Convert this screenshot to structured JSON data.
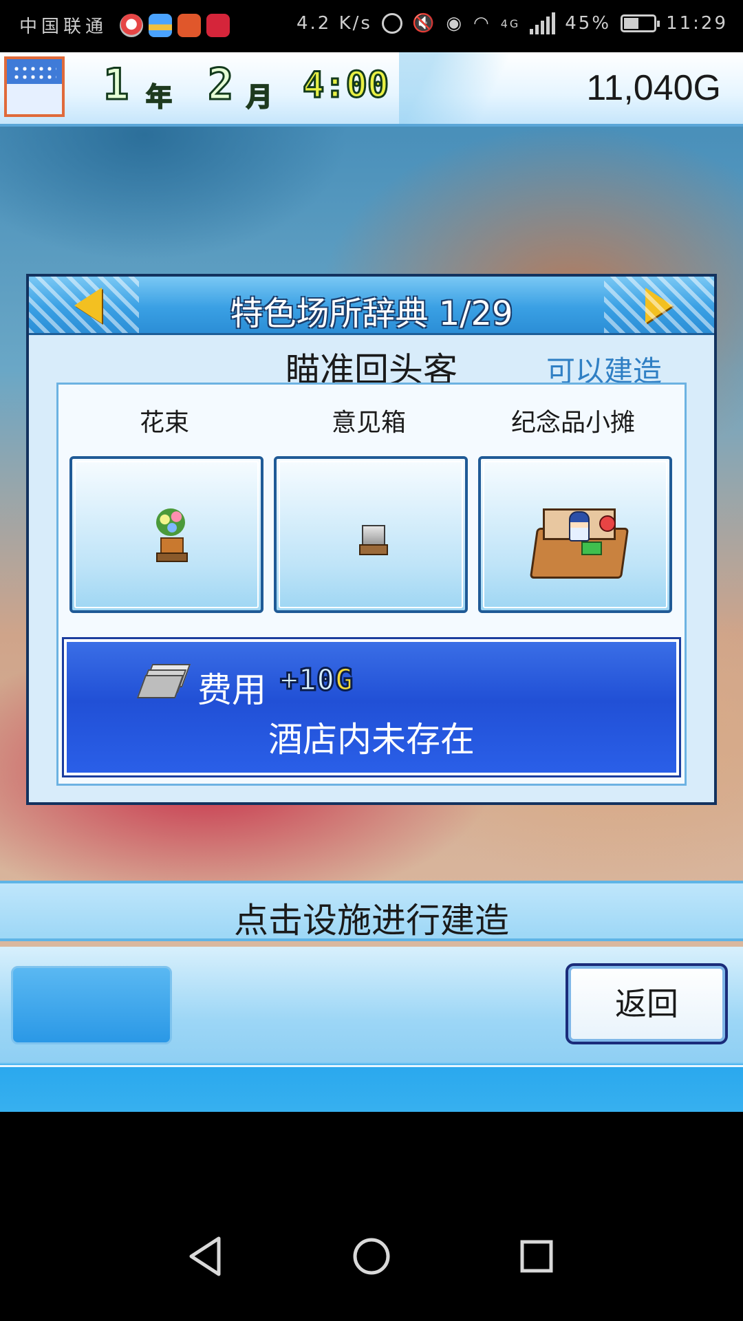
{
  "status_bar": {
    "carrier": "中国联通",
    "net_speed": "4.2 K/s",
    "signal_type": "4G",
    "battery": "45%",
    "time": "11:29"
  },
  "top_bar": {
    "year_num": "1",
    "year_unit": "年",
    "month_num": "2",
    "month_unit": "月",
    "time": "4:00",
    "gold": "11,040G",
    "season_icon": "winter-snow-icon"
  },
  "dialog": {
    "title": "特色场所辞典 1/29",
    "subtitle": "瞄准回头客",
    "status": "可以建造",
    "facilities": [
      {
        "label": "花束",
        "icon": "flower-bouquet-icon"
      },
      {
        "label": "意见箱",
        "icon": "suggestion-box-icon"
      },
      {
        "label": "纪念品小摊",
        "icon": "souvenir-stand-icon"
      }
    ],
    "cost_label": "费用",
    "cost_value_prefix": "+10",
    "cost_value_unit": "G",
    "status_line": "酒店内未存在"
  },
  "hint": {
    "text": "点击设施进行建造"
  },
  "bottom": {
    "back_label": "返回"
  },
  "colors": {
    "accent_blue": "#2a98e6",
    "panel_blue": "#2150d6",
    "status_text": "#2f7fc4",
    "arrow_yellow": "#f3c021"
  }
}
